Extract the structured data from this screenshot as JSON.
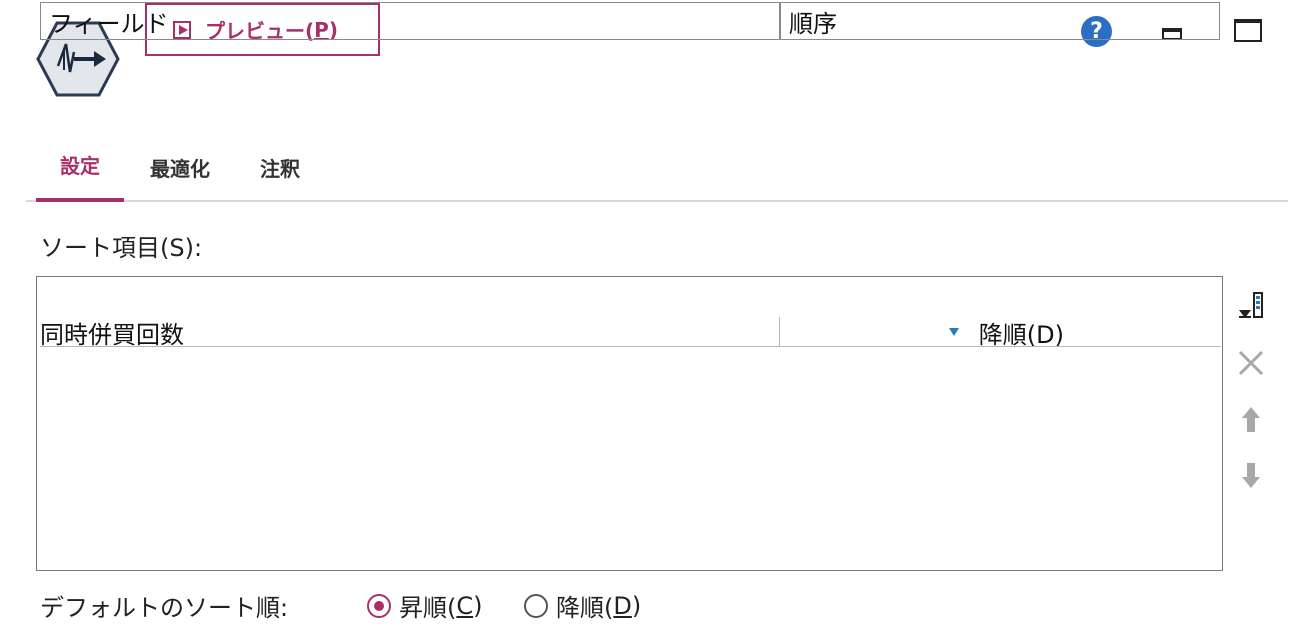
{
  "toolbar": {
    "node_icon": "sort-node-icon",
    "preview_label": "プレビュー(",
    "preview_key": "P",
    "preview_close": ")",
    "help_icon": "help-icon",
    "help_glyph": "?",
    "minimize_icon": "minimize-icon",
    "maximize_icon": "maximize-icon"
  },
  "tabs": [
    {
      "label": "設定",
      "active": true
    },
    {
      "label": "最適化",
      "active": false
    },
    {
      "label": "注釈",
      "active": false
    }
  ],
  "sort_section": {
    "label": "ソート項目(S):",
    "columns": [
      "フィールド",
      "順序"
    ],
    "rows": [
      {
        "field": "同時併買回数",
        "order": "降順(D)",
        "order_icon": "descending-triangle-icon"
      }
    ]
  },
  "side_tools": [
    {
      "name": "add-field-icon"
    },
    {
      "name": "delete-icon"
    },
    {
      "name": "move-up-icon"
    },
    {
      "name": "move-down-icon"
    }
  ],
  "default_order": {
    "label": "デフォルトのソート順:",
    "options": [
      {
        "text_pre": "昇順(",
        "key": "C",
        "text_post": ")",
        "checked": true
      },
      {
        "text_pre": "降順(",
        "key": "D",
        "text_post": ")",
        "checked": false
      }
    ]
  },
  "colors": {
    "accent": "#a8306a",
    "help_blue": "#2b6fc4"
  }
}
